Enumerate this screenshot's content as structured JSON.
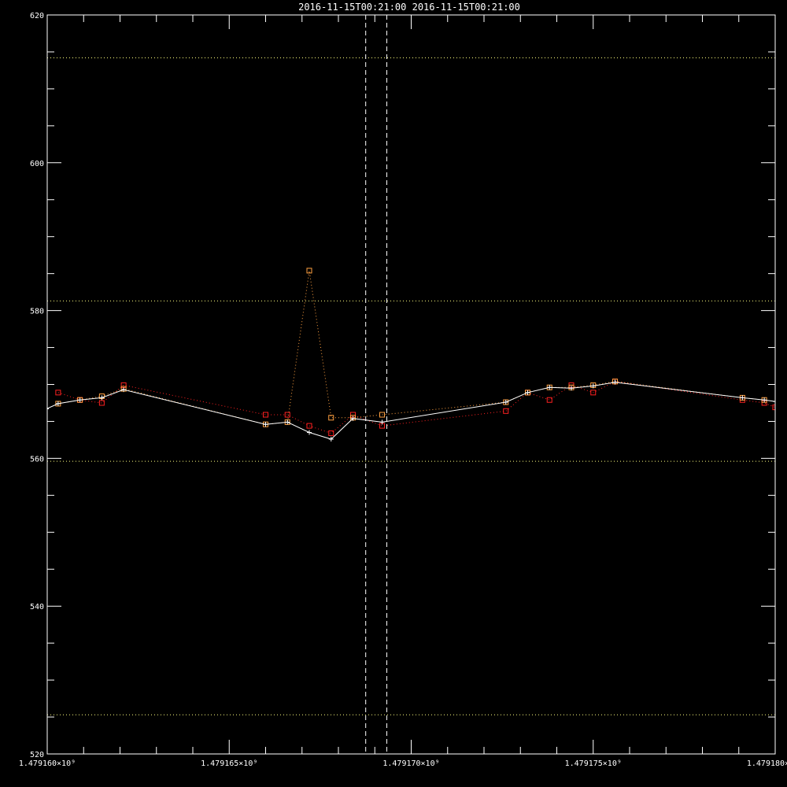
{
  "chart_data": {
    "type": "line",
    "title": "2016-11-15T00:21:00  2016-11-15T00:21:00",
    "xlim": [
      1479160000,
      1479180000
    ],
    "ylim": [
      520,
      620
    ],
    "x_ticks": [
      1479160000,
      1479165000,
      1479170000,
      1479175000,
      1479180000
    ],
    "x_tick_labels": [
      "1.479160×10⁹",
      "1.479165×10⁹",
      "1.479170×10⁹",
      "1.479175×10⁹",
      "1.479180×10⁹"
    ],
    "y_ticks": [
      520,
      540,
      560,
      580,
      600,
      620
    ],
    "y_tick_labels": [
      "520",
      "540",
      "560",
      "580",
      "600",
      "620"
    ],
    "vertical_markers": [
      1479168750,
      1479169330
    ],
    "horizontal_reference_lines": [
      525.3,
      559.6,
      581.3,
      614.2
    ],
    "grid": false,
    "colors": {
      "background": "#000000",
      "axes": "#ffffff",
      "white_series": "#ffffff",
      "red_series": "#ff2020",
      "orange_series": "#ffa040",
      "reference_lines": "#ffff80",
      "markers": "#ffffff"
    },
    "series": [
      {
        "style": "white solid line with plus markers",
        "points": [
          [
            1479159980,
            566.7
          ],
          [
            1479160300,
            567.4
          ],
          [
            1479160900,
            567.9
          ],
          [
            1479161500,
            568.2
          ],
          [
            1479162100,
            569.3
          ],
          [
            1479166000,
            564.6
          ],
          [
            1479166600,
            564.9
          ],
          [
            1479167200,
            563.5
          ],
          [
            1479167800,
            562.6
          ],
          [
            1479168400,
            565.4
          ],
          [
            1479169200,
            564.9
          ],
          [
            1479172600,
            567.6
          ],
          [
            1479173200,
            568.9
          ],
          [
            1479173800,
            569.6
          ],
          [
            1479174400,
            569.5
          ],
          [
            1479175000,
            569.8
          ],
          [
            1479175600,
            570.3
          ],
          [
            1479179100,
            568.2
          ],
          [
            1479179700,
            567.9
          ],
          [
            1479180000,
            567.7
          ]
        ]
      },
      {
        "style": "red dotted line with square markers",
        "points": [
          [
            1479160300,
            568.9
          ],
          [
            1479160900,
            567.9
          ],
          [
            1479161500,
            567.5
          ],
          [
            1479162100,
            569.9
          ],
          [
            1479166000,
            565.9
          ],
          [
            1479166600,
            565.9
          ],
          [
            1479167200,
            564.4
          ],
          [
            1479167800,
            563.4
          ],
          [
            1479168400,
            565.9
          ],
          [
            1479169200,
            564.4
          ],
          [
            1479172600,
            566.4
          ],
          [
            1479173200,
            568.9
          ],
          [
            1479173800,
            567.9
          ],
          [
            1479174400,
            569.9
          ],
          [
            1479175000,
            568.9
          ],
          [
            1479175600,
            570.4
          ],
          [
            1479179100,
            567.9
          ],
          [
            1479179700,
            567.5
          ],
          [
            1479180000,
            566.9
          ]
        ]
      },
      {
        "style": "orange dotted line with square markers",
        "points": [
          [
            1479160300,
            567.4
          ],
          [
            1479160900,
            567.9
          ],
          [
            1479161500,
            568.4
          ],
          [
            1479162100,
            569.4
          ],
          [
            1479166000,
            564.6
          ],
          [
            1479166600,
            564.9
          ],
          [
            1479167200,
            585.4
          ],
          [
            1479167800,
            565.5
          ],
          [
            1479168400,
            565.5
          ],
          [
            1479169200,
            565.9
          ],
          [
            1479172600,
            567.6
          ],
          [
            1479173200,
            568.9
          ],
          [
            1479173800,
            569.6
          ],
          [
            1479174400,
            569.6
          ],
          [
            1479175000,
            569.9
          ],
          [
            1479175600,
            570.4
          ],
          [
            1479179100,
            568.2
          ],
          [
            1479179700,
            567.9
          ]
        ]
      }
    ]
  }
}
